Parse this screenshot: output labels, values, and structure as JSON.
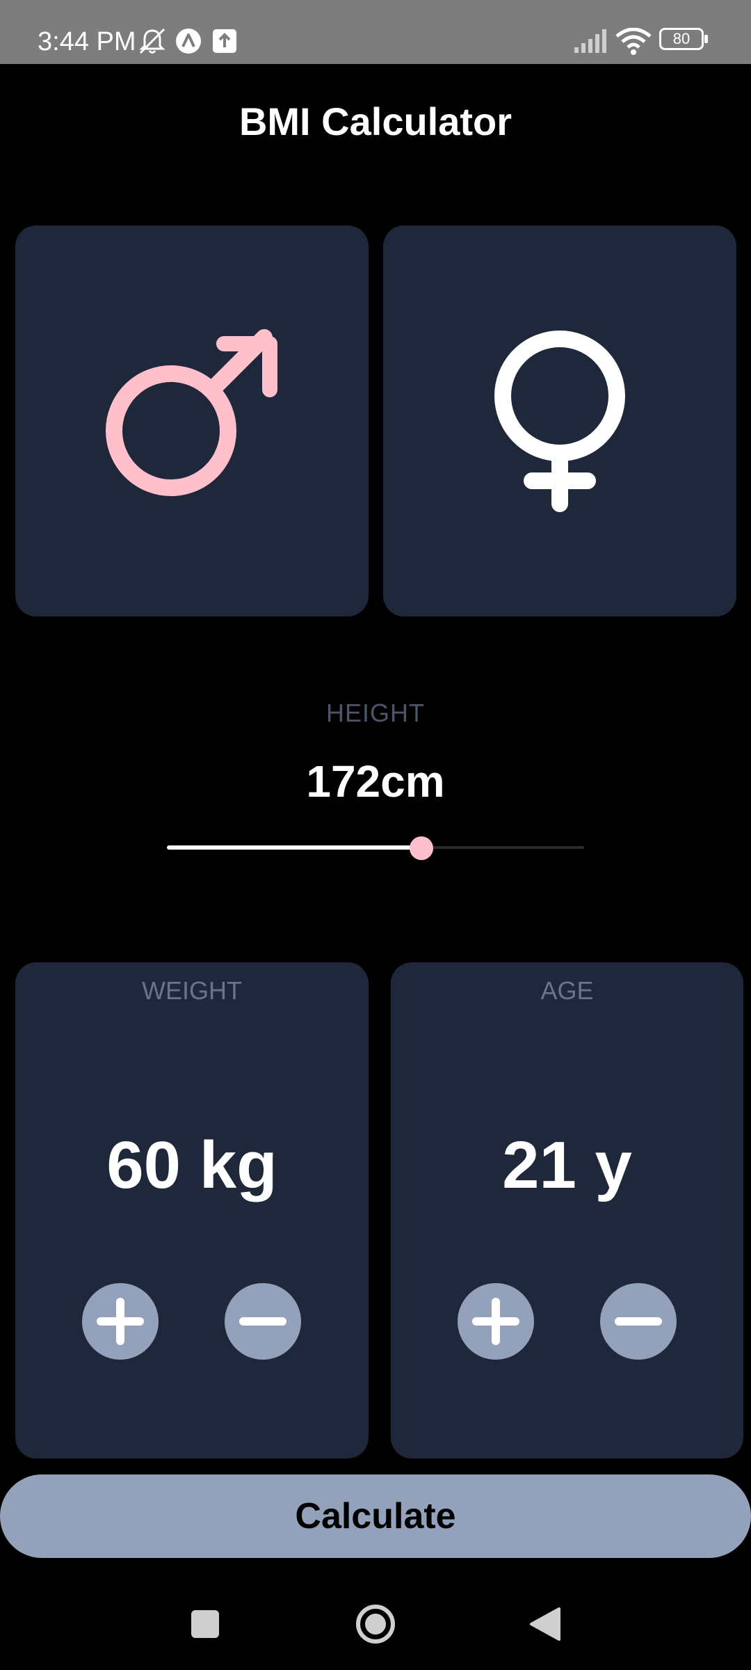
{
  "status_bar": {
    "time": "3:44 PM",
    "battery": "80",
    "icons": [
      "bell-off-icon",
      "app-a-icon",
      "upload-icon",
      "signal-icon",
      "wifi-icon",
      "battery-icon"
    ]
  },
  "app": {
    "title": "BMI Calculator",
    "accent_color": "#ffc0cb",
    "card_color": "#1e283a",
    "button_color": "#93a2ba"
  },
  "gender": {
    "options": [
      "male",
      "female"
    ],
    "icons": [
      "male-symbol-icon",
      "female-symbol-icon"
    ],
    "selected": "male"
  },
  "height": {
    "label": "HEIGHT",
    "value_text": "172cm",
    "slider_fraction": 0.61
  },
  "weight": {
    "label": "WEIGHT",
    "value_text": "60 kg"
  },
  "age": {
    "label": "AGE",
    "value_text": "21 y"
  },
  "calculate": {
    "label": "Calculate"
  },
  "nav_bar": {
    "icons": [
      "recents-square-icon",
      "home-circle-icon",
      "back-triangle-icon"
    ]
  }
}
